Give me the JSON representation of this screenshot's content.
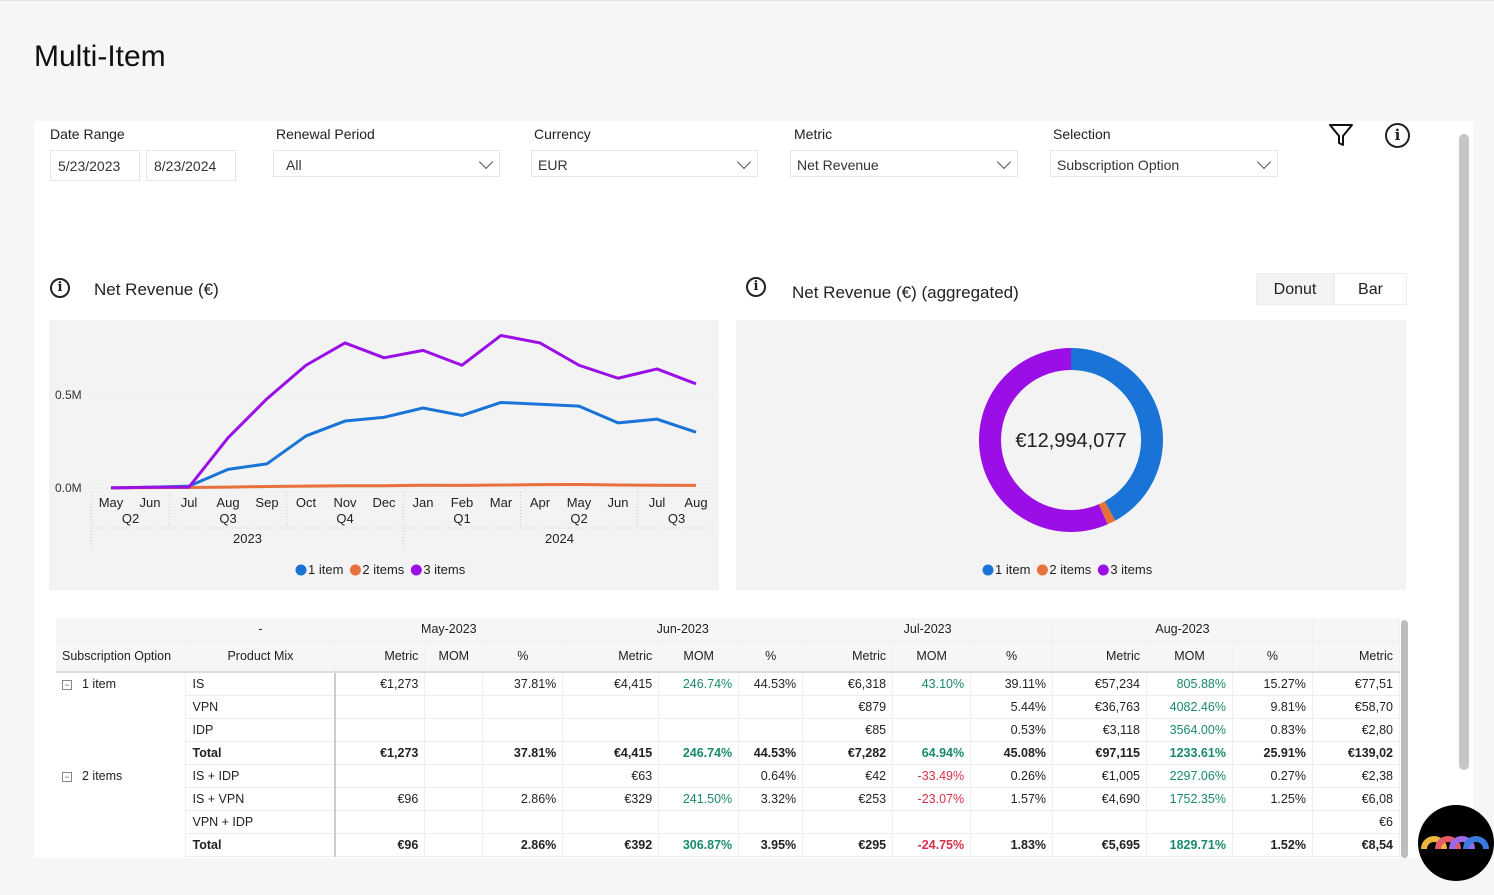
{
  "page": {
    "title": "Multi-Item"
  },
  "filters": {
    "date_range": {
      "label": "Date Range",
      "start": "5/23/2023",
      "end": "8/23/2024"
    },
    "renewal_period": {
      "label": "Renewal Period",
      "value": "All"
    },
    "currency": {
      "label": "Currency",
      "value": "EUR"
    },
    "metric": {
      "label": "Metric",
      "value": "Net Revenue"
    },
    "selection": {
      "label": "Selection",
      "value": "Subscription Option"
    }
  },
  "toolbar": {
    "filter_icon": "funnel-icon",
    "info_icon": "info-icon"
  },
  "colors": {
    "1 item": "#1a73d6",
    "2 items": "#e8703a",
    "3 items": "#9b0fe6",
    "positive": "#1a8a6a",
    "negative": "#d9304a"
  },
  "line_chart": {
    "title": "Net Revenue (€)"
  },
  "donut_chart": {
    "title": "Net Revenue (€) (aggregated)",
    "center_label": "€12,994,077",
    "toggle": {
      "options": [
        "Donut",
        "Bar"
      ],
      "selected": "Donut"
    }
  },
  "chart_data": [
    {
      "type": "line",
      "title": "Net Revenue (€)",
      "yticks": [
        "0.0M",
        "0.5M"
      ],
      "ylim": [
        0,
        0.85
      ],
      "x": [
        "May",
        "Jun",
        "Jul",
        "Aug",
        "Sep",
        "Oct",
        "Nov",
        "Dec",
        "Jan",
        "Feb",
        "Mar",
        "Apr",
        "May",
        "Jun",
        "Jul",
        "Aug"
      ],
      "quarters": [
        {
          "label": "Q2",
          "span": 2
        },
        {
          "label": "Q3",
          "span": 3
        },
        {
          "label": "Q4",
          "span": 3
        },
        {
          "label": "Q1",
          "span": 3
        },
        {
          "label": "Q2",
          "span": 3
        },
        {
          "label": "Q3",
          "span": 2
        }
      ],
      "years": [
        {
          "label": "2023",
          "span": 8
        },
        {
          "label": "2024",
          "span": 8
        }
      ],
      "legend": "bottom",
      "series": [
        {
          "name": "1 item",
          "color": "#1a73d6",
          "values": [
            0.001,
            0.004,
            0.01,
            0.1,
            0.13,
            0.28,
            0.36,
            0.38,
            0.43,
            0.39,
            0.46,
            0.45,
            0.44,
            0.35,
            0.37,
            0.3
          ]
        },
        {
          "name": "2 items",
          "color": "#e8703a",
          "values": [
            0.001,
            0.002,
            0.003,
            0.005,
            0.008,
            0.01,
            0.012,
            0.012,
            0.015,
            0.014,
            0.016,
            0.018,
            0.019,
            0.016,
            0.015,
            0.014
          ]
        },
        {
          "name": "3 items",
          "color": "#9b0fe6",
          "values": [
            0.001,
            0.004,
            0.005,
            0.27,
            0.48,
            0.66,
            0.78,
            0.7,
            0.74,
            0.66,
            0.82,
            0.78,
            0.66,
            0.59,
            0.64,
            0.56
          ]
        }
      ]
    },
    {
      "type": "pie",
      "title": "Net Revenue (€) (aggregated)",
      "center": "€12,994,077",
      "legend": "bottom",
      "series": [
        {
          "name": "1 item",
          "color": "#1a73d6",
          "share": 0.42
        },
        {
          "name": "2 items",
          "color": "#e8703a",
          "share": 0.015
        },
        {
          "name": "3 items",
          "color": "#9b0fe6",
          "share": 0.565
        }
      ]
    }
  ],
  "table": {
    "corner": "-",
    "row_headers": [
      "Subscription Option",
      "Product Mix"
    ],
    "months": [
      "May-2023",
      "Jun-2023",
      "Jul-2023",
      "Aug-2023"
    ],
    "subcols": [
      "Metric",
      "MOM",
      "%"
    ],
    "last_col": "Metric",
    "rows": [
      {
        "group": "1 item",
        "product": "IS",
        "cells": [
          "€1,273",
          "",
          "37.81%",
          "€4,415",
          "246.74%",
          "44.53%",
          "€6,318",
          "43.10%",
          "39.11%",
          "€57,234",
          "805.88%",
          "15.27%",
          "€77,51"
        ]
      },
      {
        "group": "",
        "product": "VPN",
        "cells": [
          "",
          "",
          "",
          "",
          "",
          "",
          "€879",
          "",
          "5.44%",
          "€36,763",
          "4082.46%",
          "9.81%",
          "€58,70"
        ]
      },
      {
        "group": "",
        "product": "IDP",
        "cells": [
          "",
          "",
          "",
          "",
          "",
          "",
          "€85",
          "",
          "0.53%",
          "€3,118",
          "3564.00%",
          "0.83%",
          "€2,80"
        ]
      },
      {
        "group": "",
        "product": "Total",
        "total": true,
        "cells": [
          "€1,273",
          "",
          "37.81%",
          "€4,415",
          "246.74%",
          "44.53%",
          "€7,282",
          "64.94%",
          "45.08%",
          "€97,115",
          "1233.61%",
          "25.91%",
          "€139,02"
        ]
      },
      {
        "group": "2 items",
        "product": "IS + IDP",
        "cells": [
          "",
          "",
          "",
          "€63",
          "",
          "0.64%",
          "€42",
          "-33.49%",
          "0.26%",
          "€1,005",
          "2297.06%",
          "0.27%",
          "€2,38"
        ]
      },
      {
        "group": "",
        "product": "IS + VPN",
        "cells": [
          "€96",
          "",
          "2.86%",
          "€329",
          "241.50%",
          "3.32%",
          "€253",
          "-23.07%",
          "1.57%",
          "€4,690",
          "1752.35%",
          "1.25%",
          "€6,08"
        ]
      },
      {
        "group": "",
        "product": "VPN + IDP",
        "cells": [
          "",
          "",
          "",
          "",
          "",
          "",
          "",
          "",
          "",
          "",
          "",
          "",
          "€6"
        ]
      },
      {
        "group": "",
        "product": "Total",
        "total": true,
        "cells": [
          "€96",
          "",
          "2.86%",
          "€392",
          "306.87%",
          "3.95%",
          "€295",
          "-24.75%",
          "1.83%",
          "€5,695",
          "1829.71%",
          "1.52%",
          "€8,54"
        ]
      }
    ]
  }
}
